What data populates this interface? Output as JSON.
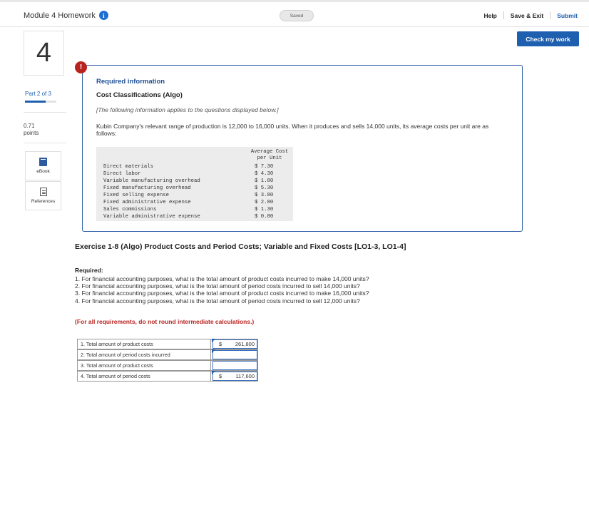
{
  "header": {
    "title": "Module 4 Homework",
    "info_icon": "i",
    "saved_label": "Saved",
    "help_label": "Help",
    "save_exit_label": "Save & Exit",
    "submit_label": "Submit",
    "check_work_label": "Check my work"
  },
  "rail": {
    "question_number": "4",
    "part_label": "Part 2 of 3",
    "part_progress": 0.67,
    "points_value": "0.71",
    "points_label": "points",
    "ebook_label": "eBook",
    "references_label": "References"
  },
  "info": {
    "alert_icon": "!",
    "heading": "Required information",
    "subheading": "Cost Classifications (Algo)",
    "following": "[The following information applies to the questions displayed below.]",
    "intro": "Kubin Company's relevant range of production is 12,000 to 16,000 units. When it produces and sells 14,000 units, its average costs per unit are as follows:",
    "table_head_1": "Average Cost",
    "table_head_2": "per Unit",
    "costs": [
      {
        "label": "Direct materials",
        "value": "$ 7.30"
      },
      {
        "label": "Direct labor",
        "value": "$ 4.30"
      },
      {
        "label": "Variable manufacturing overhead",
        "value": "$ 1.80"
      },
      {
        "label": "Fixed manufacturing overhead",
        "value": "$ 5.30"
      },
      {
        "label": "Fixed selling expense",
        "value": "$ 3.80"
      },
      {
        "label": "Fixed administrative expense",
        "value": "$ 2.80"
      },
      {
        "label": "Sales commissions",
        "value": "$ 1.30"
      },
      {
        "label": "Variable administrative expense",
        "value": "$ 0.80"
      }
    ]
  },
  "exercise": {
    "title": "Exercise 1-8 (Algo) Product Costs and Period Costs; Variable and Fixed Costs [LO1-3, LO1-4]",
    "required_label": "Required:",
    "requirements": [
      "1. For financial accounting purposes, what is the total amount of product costs incurred to make 14,000 units?",
      "2. For financial accounting purposes, what is the total amount of period costs incurred to sell 14,000 units?",
      "3. For financial accounting purposes, what is the total amount of product costs incurred to make 16,000 units?",
      "4. For financial accounting purposes, what is the total amount of period costs incurred to sell 12,000 units?"
    ],
    "round_note": "(For all requirements, do not round intermediate calculations.)"
  },
  "answers": [
    {
      "label": "1. Total amount of product costs",
      "dollar": "$",
      "value": "261,800"
    },
    {
      "label": "2. Total amount of period costs incurred",
      "dollar": "",
      "value": ""
    },
    {
      "label": "3. Total amount of product costs",
      "dollar": "",
      "value": ""
    },
    {
      "label": "4. Total amount of period costs",
      "dollar": "$",
      "value": "117,600"
    }
  ],
  "colors": {
    "accent": "#1f5fb0",
    "alert": "#b8231f"
  }
}
